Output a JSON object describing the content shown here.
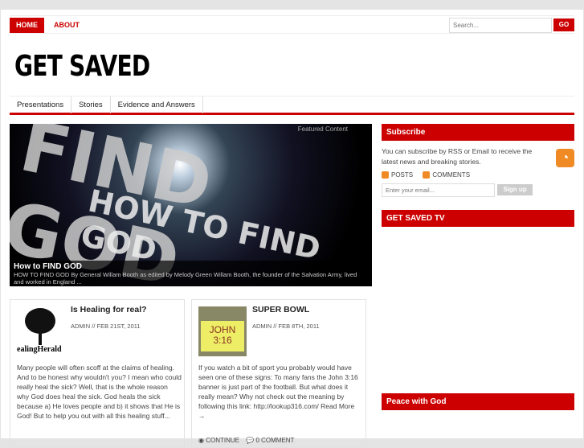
{
  "topnav": {
    "items": [
      {
        "label": "HOME"
      },
      {
        "label": "ABOUT"
      }
    ],
    "search_placeholder": "Search...",
    "go": "GO"
  },
  "site": {
    "title": "GET SAVED"
  },
  "menu": {
    "items": [
      {
        "label": "Presentations"
      },
      {
        "label": "Stories"
      },
      {
        "label": "Evidence and Answers"
      }
    ]
  },
  "featured": {
    "tag": "Featured Content",
    "image_text": "FIND GOD",
    "image_subtext": "HOW TO FIND GOD",
    "title": "How to FIND GOD",
    "excerpt": "HOW TO FIND GOD By General Willam Booth as edited by Melody Green Willam Booth, the founder of the Salvation Army, lived and worked in England ..."
  },
  "posts": [
    {
      "title": "Is Healing for real?",
      "meta": "ADMIN // FEB 21ST, 2011",
      "thumb_text": "ealingHerald",
      "text": "Many people will often scoff at the claims of healing. And to be honest why wouldn't you? I mean who could really heal the sick? Well, that is the whole reason why God does heal the sick. God heals the sick because a) He loves people and b) it shows that He is God! But to help you out with all this healing stuff..."
    },
    {
      "title": "SUPER BOWL",
      "meta": "ADMIN // FEB 8TH, 2011",
      "thumb_text": "JOHN 3:16",
      "text": "If you watch a bit of sport you probably would have seen one of these signs: To many fans the John 3:16 banner is just part of the football. But what does it really mean? Why not check out the meaning by following this link: http://lookup316.com/  Read More →",
      "continue": "CONTINUE",
      "comments": "0 COMMENT"
    }
  ],
  "sidebar": {
    "subscribe_title": "Subscribe",
    "subscribe_text": "You can subscribe by RSS or Email to receive the latest news and breaking stories.",
    "posts": "POSTS",
    "comments": "COMMENTS",
    "email_placeholder": "Enter your email...",
    "signup": "Sign up",
    "tv_title": "GET SAVED TV",
    "peace_title": "Peace with God"
  },
  "colors": {
    "accent": "#cc0000"
  }
}
